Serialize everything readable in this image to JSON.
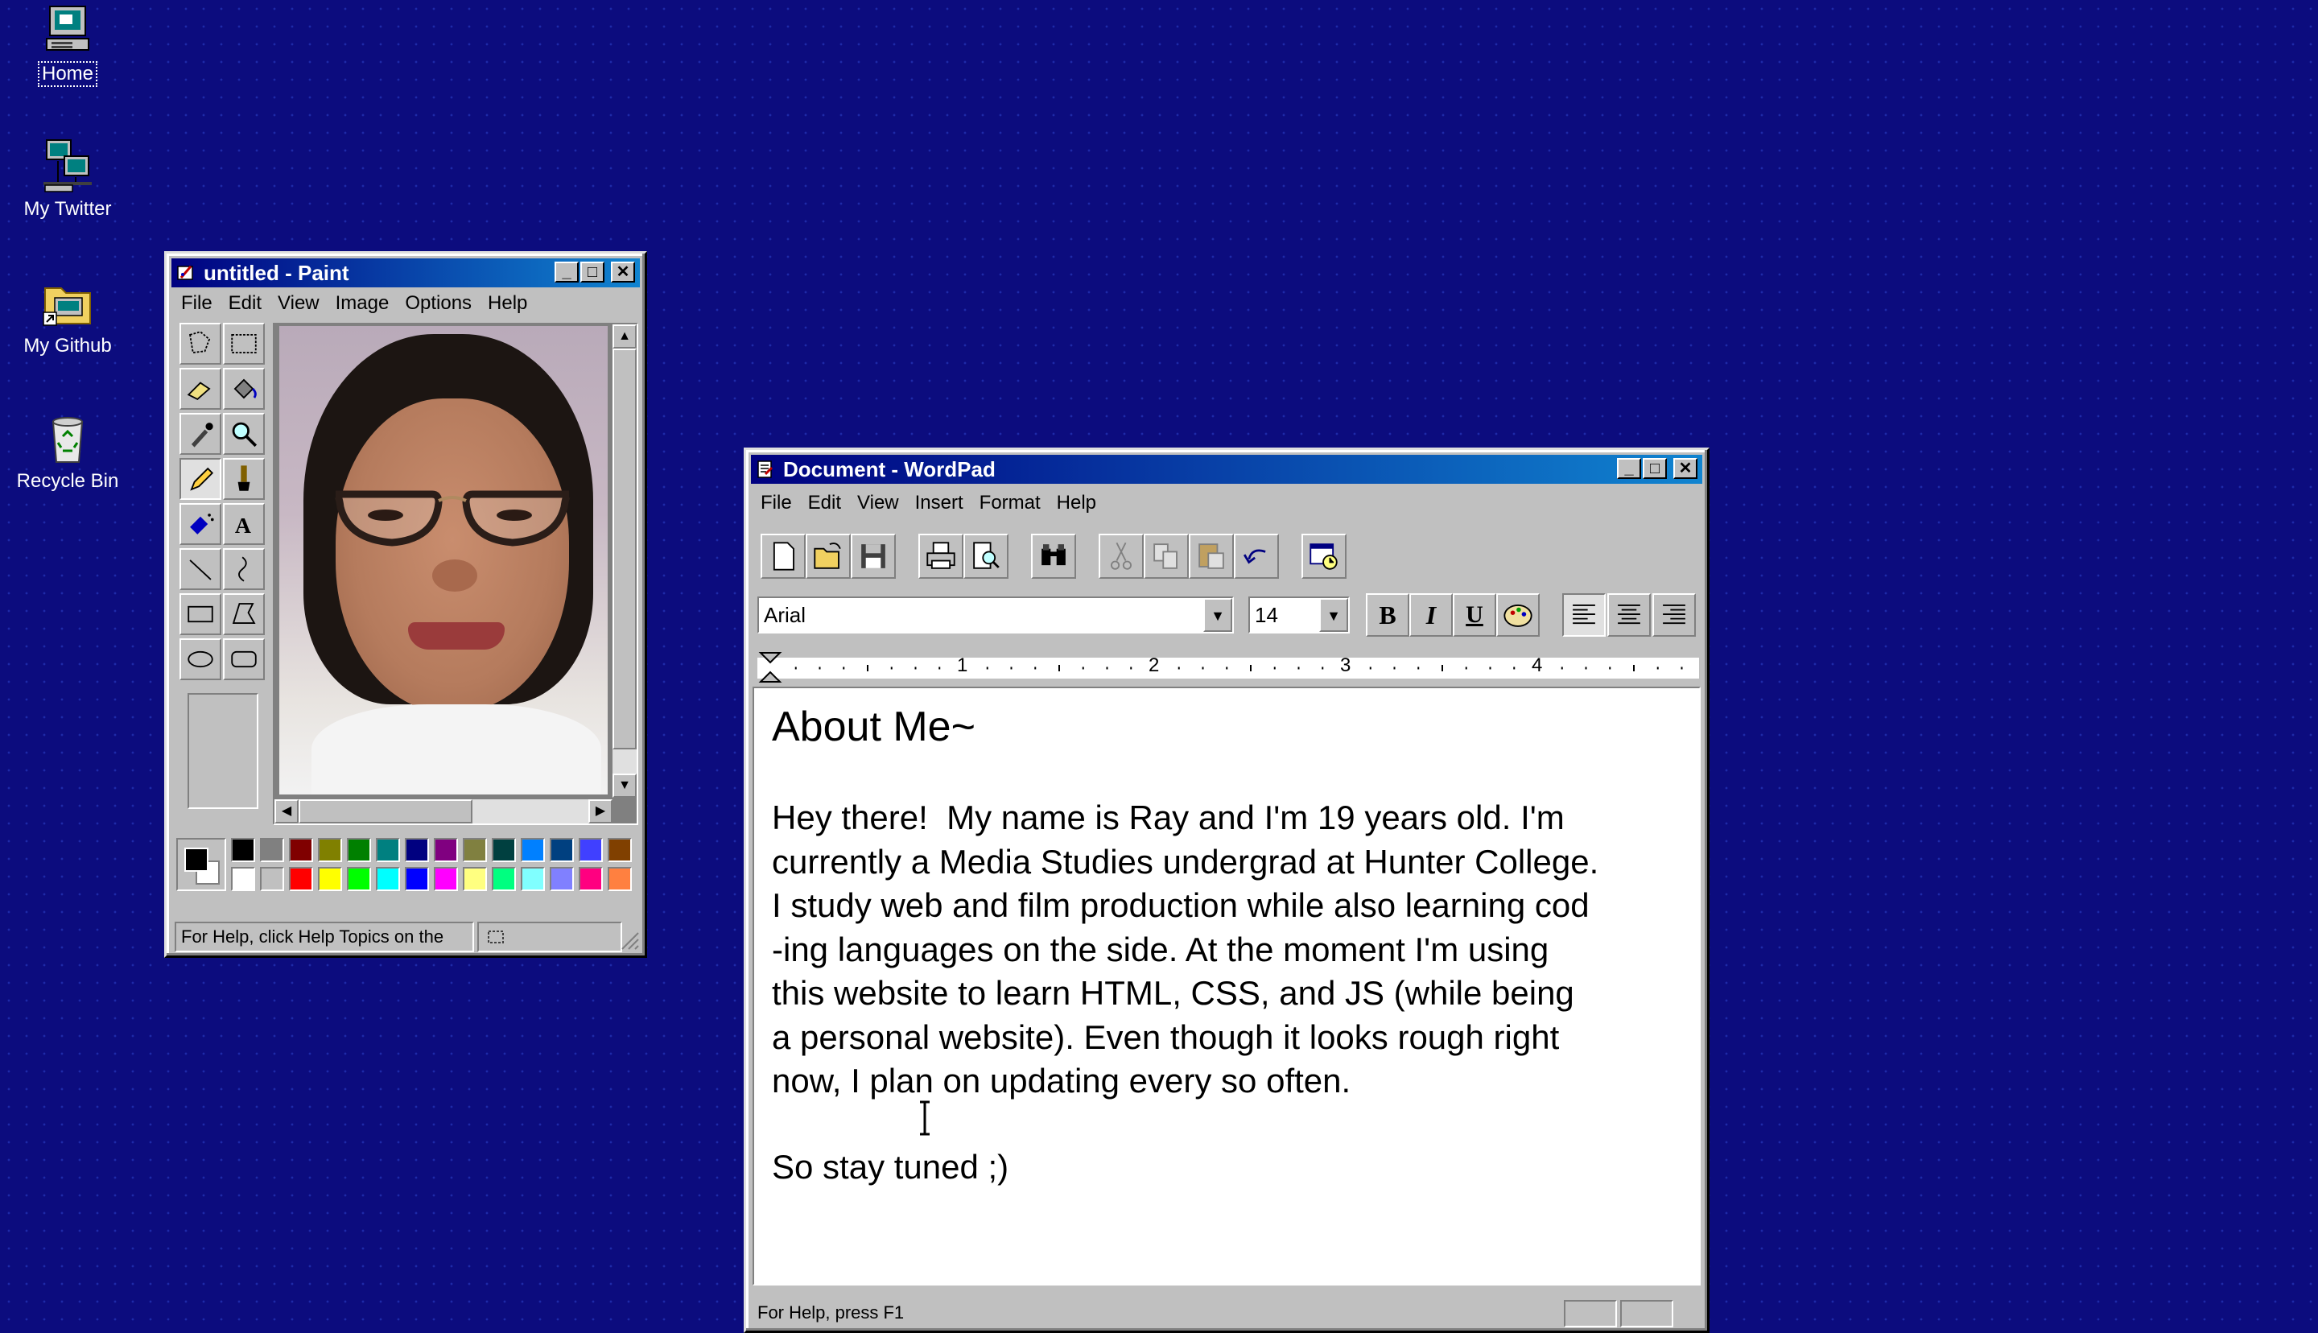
{
  "desktop": {
    "background_color": "#0c0c7e",
    "icons": [
      {
        "label": "Home",
        "icon": "computer-icon",
        "selected": true
      },
      {
        "label": "My Twitter",
        "icon": "network-icon"
      },
      {
        "label": "My Github",
        "icon": "folder-shortcut-icon"
      },
      {
        "label": "Recycle Bin",
        "icon": "recycle-bin-icon"
      }
    ]
  },
  "paint": {
    "title": "untitled - Paint",
    "menu": [
      "File",
      "Edit",
      "View",
      "Image",
      "Options",
      "Help"
    ],
    "status": "For Help, click Help Topics on the",
    "canvas_image": "portrait-photo",
    "palette_colors": [
      "#000000",
      "#808080",
      "#800000",
      "#808000",
      "#008000",
      "#008080",
      "#000080",
      "#800080",
      "#808040",
      "#004040",
      "#0080ff",
      "#004080",
      "#4040ff",
      "#804000",
      "#ffffff",
      "#c0c0c0",
      "#ff0000",
      "#ffff00",
      "#00ff00",
      "#00ffff",
      "#0000ff",
      "#ff00ff",
      "#ffff80",
      "#00ff80",
      "#80ffff",
      "#8080ff",
      "#ff0080",
      "#ff8040"
    ]
  },
  "wordpad": {
    "title": "Document - WordPad",
    "menu": [
      "File",
      "Edit",
      "View",
      "Insert",
      "Format",
      "Help"
    ],
    "font_name": "Arial",
    "font_size": "14",
    "ruler_numbers": [
      "1",
      "2",
      "3",
      "4"
    ],
    "doc": {
      "heading": "About Me~",
      "para1": "Hey there!  My name is Ray and I'm 19 years old. I'm currently a Media Studies undergrad at Hunter College. I study web and film production while also learning cod -ing languages on the side. At the moment I'm using this website to learn HTML, CSS, and JS (while being a personal website). Even though it looks rough right now, I plan on updating every so often.",
      "lines": [
        "Hey there!  My name is Ray and I'm 19 years old. I'm",
        "currently a Media Studies undergrad at Hunter College.",
        "I study web and film production while also learning cod",
        "-ing languages on the side. At the moment I'm using",
        "this website to learn HTML, CSS, and JS (while being",
        "a personal website). Even though it looks rough right",
        "now, I plan on updating every so often."
      ],
      "para2": "So stay tuned ;)"
    },
    "status": "For Help, press F1"
  }
}
